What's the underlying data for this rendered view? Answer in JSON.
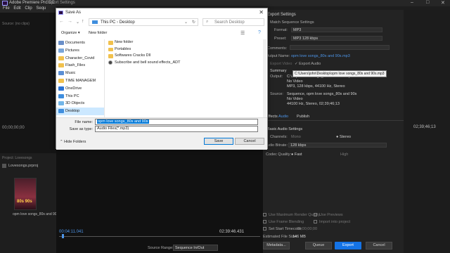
{
  "premiere": {
    "title": "Adobe Premiere Pro CC",
    "menu": [
      "File",
      "Edit",
      "Clip",
      "Sequ"
    ],
    "source_label": "Source: (no clips)",
    "src_timecode": "00;00;00;00",
    "project_label": "Project: Lovesongs",
    "project_file": "Lovesongs.prproj",
    "clip_name": "opm love songs_80s and 90s",
    "clip_thumb_text": "80s 90s",
    "right_timecode_top": "02;39;46;13",
    "right_timecode_mid": "02;39;46;13"
  },
  "export_window": {
    "title": "Export Settings",
    "section": "Export Settings",
    "match_sequence": "Match Sequence Settings",
    "format_label": "Format:",
    "format_value": "MP3",
    "preset_label": "Preset:",
    "preset_value": "MP3 128 kbps",
    "comments_label": "Comments:",
    "output_name_label": "Output Name:",
    "output_name_value": "opm love songs_80s and 90s.mp3",
    "export_video_label": "Export Video",
    "export_audio_label": "Export Audio",
    "summary_label": "Summary",
    "output_label": "Output:",
    "output_path": "C:\\...\\pm love songs_80s and 90s.mp3",
    "output_line2": "No Video",
    "output_line3": "MP3, 128 kbps, 44100 Hz, Stereo",
    "tooltip": "C:\\Users\\john\\Desktop\\opm love songs_80s and 90s.mp3",
    "source_label": "Source:",
    "source_line1": "Sequence, opm love songs_80s and 90s",
    "source_line2": "No Video",
    "source_line3": "44100 Hz, Stereo, 02;39;46;13",
    "tabs": [
      "Effects",
      "Audio",
      "Publish"
    ],
    "basic_audio_label": "Basic Audio Settings",
    "channels_label": "Channels:",
    "mono_label": "Mono",
    "stereo_label": "Stereo",
    "bitrate_label": "Audio Bitrate:",
    "bitrate_value": "128 kbps",
    "codec_quality_label": "Codec Quality:",
    "fast_label": "Fast",
    "high_label": "High",
    "max_render_label": "Use Maximum Render Quality",
    "use_previews_label": "Use Previews",
    "frame_blending_label": "Use Frame Blending",
    "import_project_label": "Import into project",
    "set_start_label": "Set Start Timecode",
    "start_timecode": "00;00;00;00",
    "file_size_label": "Estimated File Size:",
    "file_size_value": "146 MB",
    "metadata_btn": "Metadata...",
    "queue_btn": "Queue",
    "export_btn": "Export",
    "cancel_btn": "Cancel",
    "tc_left": "00:04:11.041",
    "tc_right": "02:39:46.431",
    "source_range_label": "Source Range:",
    "source_range_value": "Sequence In/Out"
  },
  "save_dialog": {
    "title": "Save As",
    "path": [
      "This PC",
      "Desktop"
    ],
    "search_placeholder": "Search Desktop",
    "organize": "Organize ▾",
    "new_folder": "New folder",
    "nav_items": [
      {
        "label": "Documents",
        "color": "#6a8fc8"
      },
      {
        "label": "Pictures",
        "color": "#7aa6d8"
      },
      {
        "label": "Character_Covid",
        "color": "#f1c14d"
      },
      {
        "label": "Flash_Files",
        "color": "#f1c14d"
      },
      {
        "label": "Music",
        "color": "#5b8fd4"
      },
      {
        "label": "TIME MANAGEM",
        "color": "#f1c14d"
      },
      {
        "label": "OneDrive",
        "color": "#2b74d6"
      },
      {
        "label": "This PC",
        "color": "#3f8ede"
      },
      {
        "label": "3D Objects",
        "color": "#72b6e8"
      },
      {
        "label": "Desktop",
        "color": "#3f8ede"
      }
    ],
    "files": [
      {
        "name": "New folder",
        "kind": "folder"
      },
      {
        "name": "Portables",
        "kind": "folder"
      },
      {
        "name": "Softwares Cracks Dll",
        "kind": "folder"
      },
      {
        "name": "Subscribe and bell sound effects_ADT",
        "kind": "media"
      }
    ],
    "file_name_label": "File name:",
    "file_name_value": "opm love songs_80s and 90s",
    "save_type_label": "Save as type:",
    "save_type_value": "Audio Files(*.mp3)",
    "hide_folders": "Hide Folders",
    "save_btn": "Save",
    "cancel_btn": "Cancel"
  }
}
